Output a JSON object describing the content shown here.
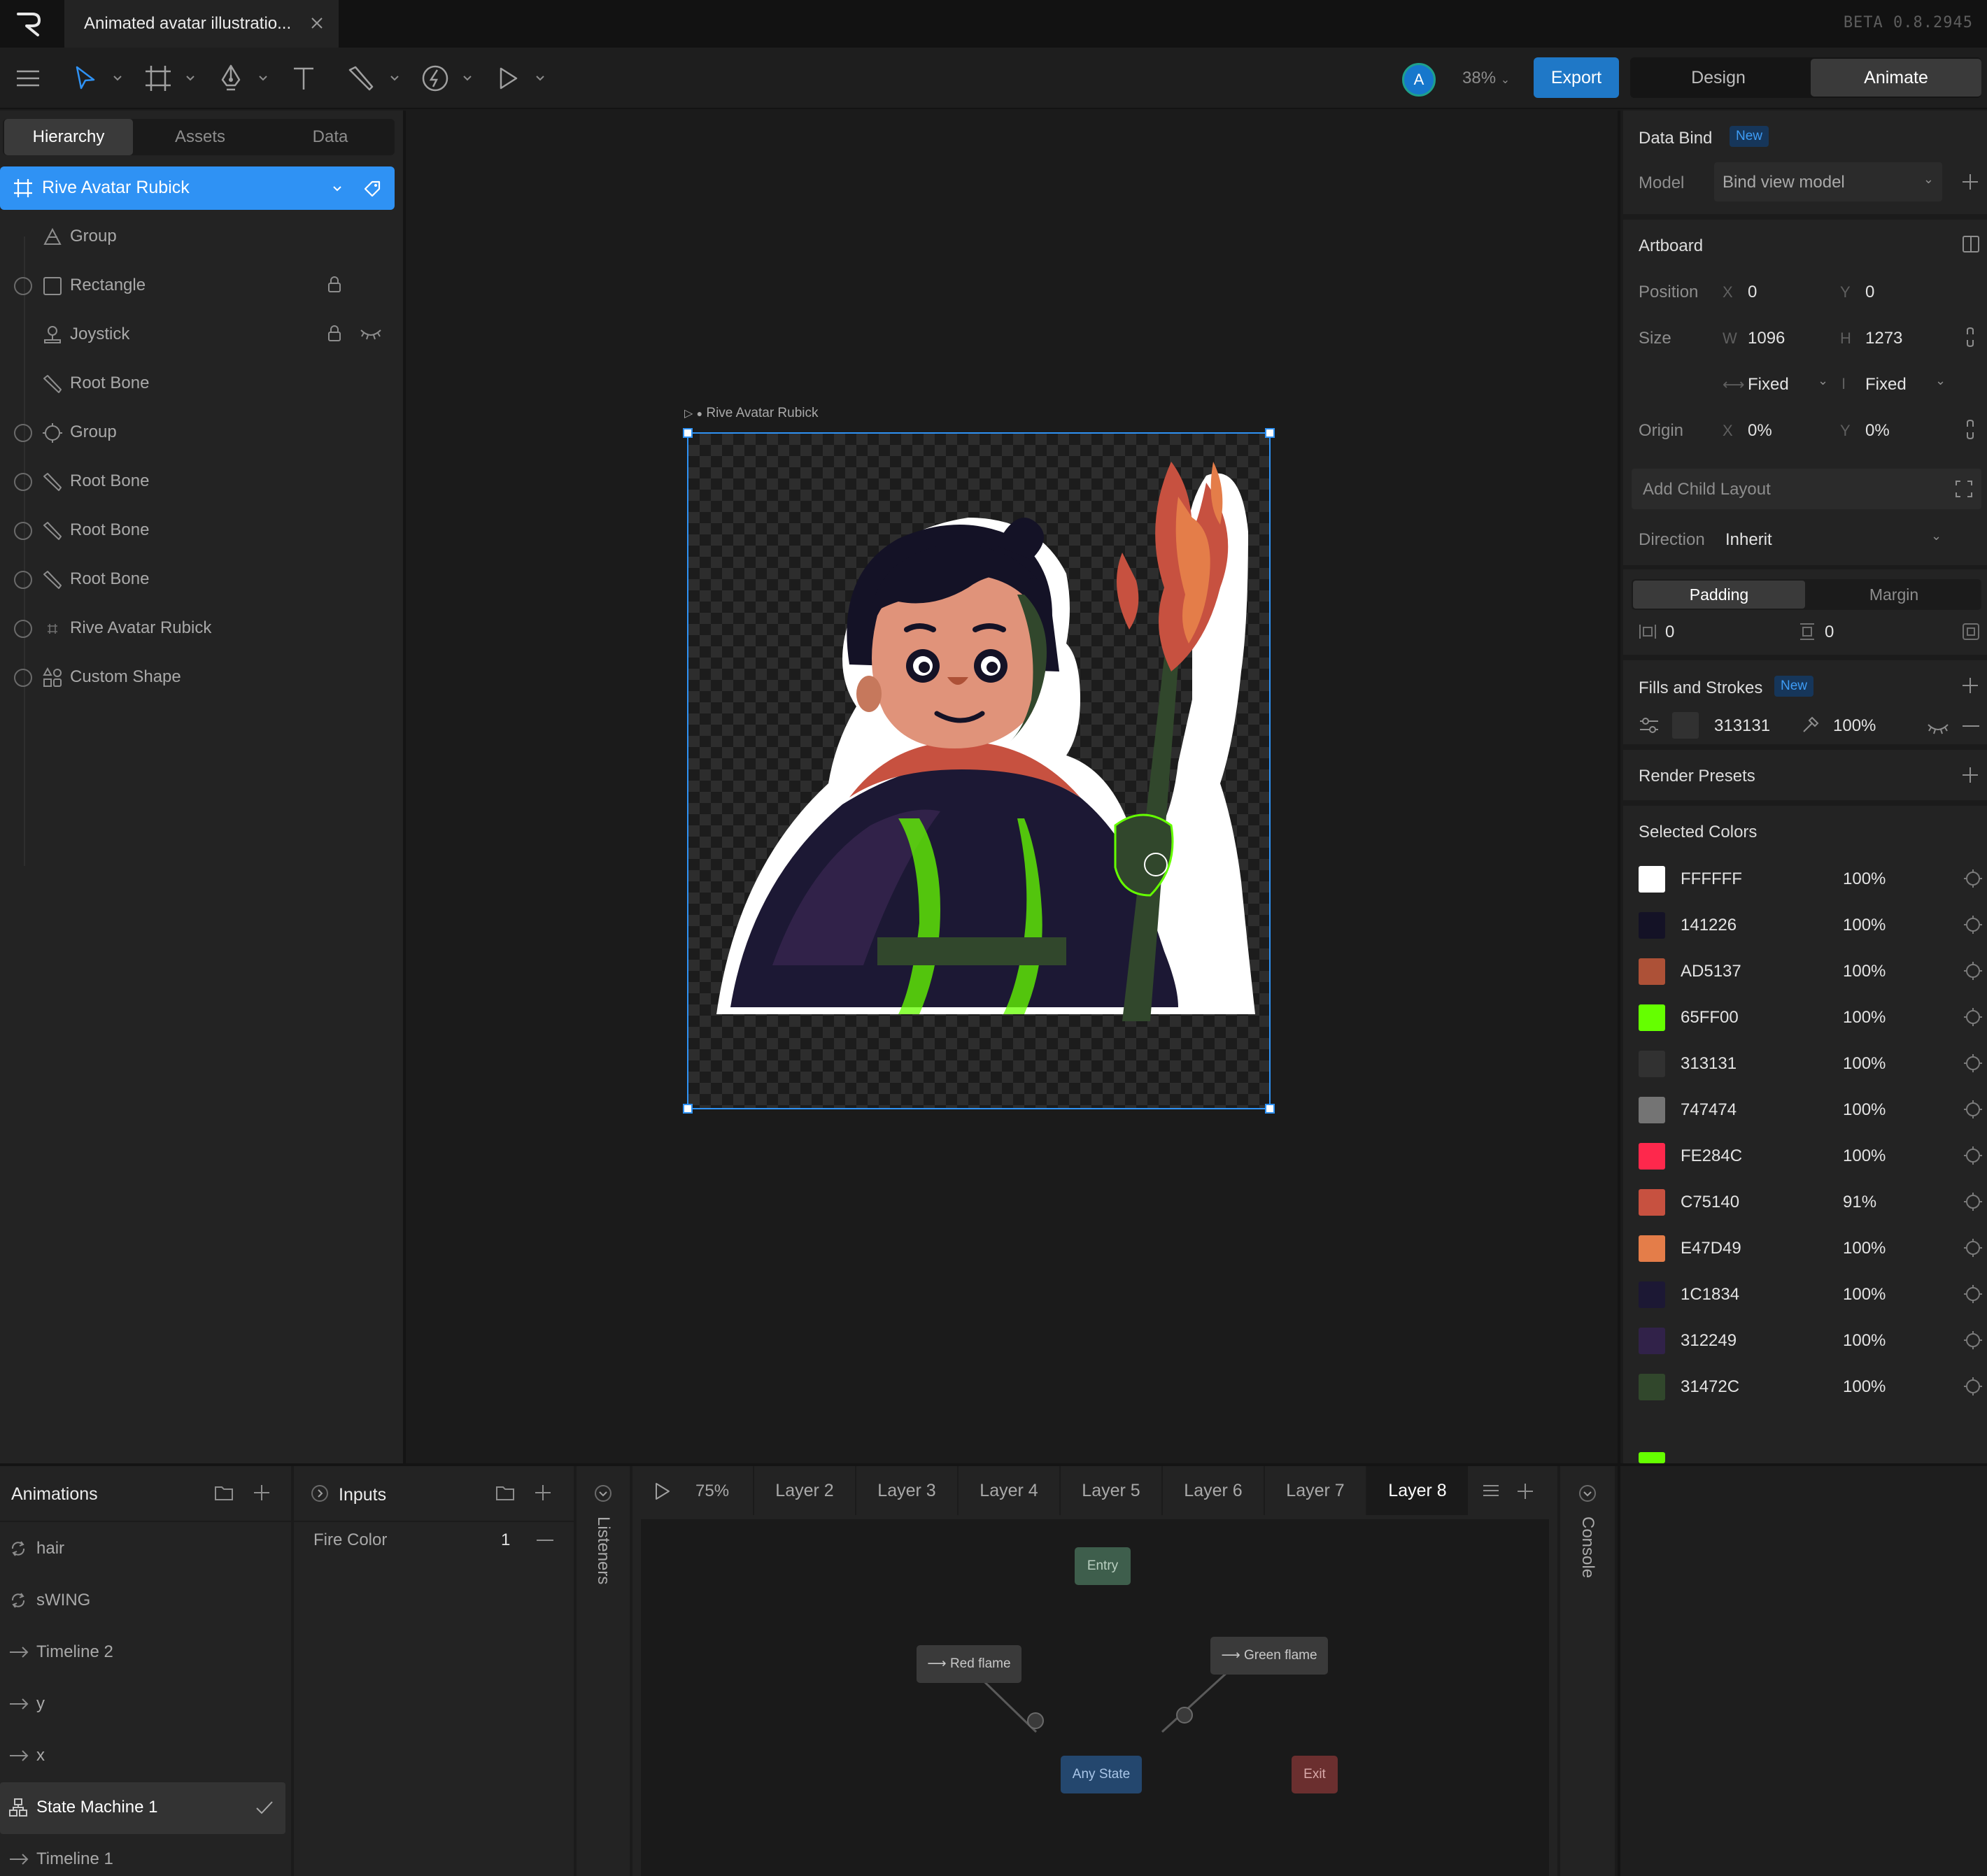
{
  "titlebar": {
    "doc_tab": "Animated avatar illustratio...",
    "version": "BETA 0.8.2945"
  },
  "toolbar": {
    "avatar_initial": "A",
    "zoom": "38%",
    "export": "Export",
    "mode_design": "Design",
    "mode_animate": "Animate"
  },
  "left": {
    "tabs": [
      "Hierarchy",
      "Assets",
      "Data"
    ],
    "root": "Rive Avatar Rubick",
    "items": [
      {
        "label": "Group",
        "icon": "group-triangle-icon"
      },
      {
        "label": "Rectangle",
        "icon": "rectangle-icon"
      },
      {
        "label": "Joystick",
        "icon": "joystick-icon"
      },
      {
        "label": "Root Bone",
        "icon": "bone-icon"
      },
      {
        "label": "Group",
        "icon": "group-target-icon"
      },
      {
        "label": "Root Bone",
        "icon": "bone-icon"
      },
      {
        "label": "Root Bone",
        "icon": "bone-icon"
      },
      {
        "label": "Root Bone",
        "icon": "bone-icon"
      },
      {
        "label": "Rive Avatar Rubick",
        "icon": "nested-artboard-icon"
      },
      {
        "label": "Custom Shape",
        "icon": "shapes-icon"
      }
    ]
  },
  "canvas": {
    "artboard_title": "Rive Avatar Rubick"
  },
  "right": {
    "data_bind": {
      "title": "Data Bind",
      "badge": "New",
      "model_label": "Model",
      "model_value": "Bind view model"
    },
    "artboard": {
      "title": "Artboard",
      "position_label": "Position",
      "x_axis": "X",
      "y_axis": "Y",
      "pos_x": "0",
      "pos_y": "0",
      "size_label": "Size",
      "w_axis": "W",
      "h_axis": "H",
      "w": "1096",
      "h": "1273",
      "w_mode": "Fixed",
      "h_mode": "Fixed",
      "origin_label": "Origin",
      "origin_x": "0%",
      "origin_y": "0%"
    },
    "layout": {
      "add_child": "Add Child Layout",
      "direction_label": "Direction",
      "direction_value": "Inherit",
      "padding_tab": "Padding",
      "margin_tab": "Margin",
      "pad_a": "0",
      "pad_b": "0"
    },
    "fills": {
      "title": "Fills and Strokes",
      "badge": "New",
      "hex": "313131",
      "opacity": "100%"
    },
    "render_presets": {
      "title": "Render Presets"
    },
    "selected_colors": {
      "title": "Selected Colors",
      "colors": [
        {
          "hex": "FFFFFF",
          "pct": "100%",
          "swatch": "#FFFFFF"
        },
        {
          "hex": "141226",
          "pct": "100%",
          "swatch": "#141226"
        },
        {
          "hex": "AD5137",
          "pct": "100%",
          "swatch": "#AD5137"
        },
        {
          "hex": "65FF00",
          "pct": "100%",
          "swatch": "#65FF00"
        },
        {
          "hex": "313131",
          "pct": "100%",
          "swatch": "#313131"
        },
        {
          "hex": "747474",
          "pct": "100%",
          "swatch": "#747474"
        },
        {
          "hex": "FE284C",
          "pct": "100%",
          "swatch": "#FE284C"
        },
        {
          "hex": "C75140",
          "pct": "91%",
          "swatch": "#C75140"
        },
        {
          "hex": "E47D49",
          "pct": "100%",
          "swatch": "#E47D49"
        },
        {
          "hex": "1C1834",
          "pct": "100%",
          "swatch": "#1C1834"
        },
        {
          "hex": "312249",
          "pct": "100%",
          "swatch": "#312249"
        },
        {
          "hex": "31472C",
          "pct": "100%",
          "swatch": "#31472C"
        }
      ]
    }
  },
  "bottom": {
    "animations": {
      "title": "Animations",
      "items": [
        {
          "label": "hair",
          "icon": "loop-icon"
        },
        {
          "label": "sWING",
          "icon": "loop-icon"
        },
        {
          "label": "Timeline 2",
          "icon": "arrow-right-icon"
        },
        {
          "label": "y",
          "icon": "arrow-right-icon"
        },
        {
          "label": "x",
          "icon": "arrow-right-icon"
        },
        {
          "label": "State Machine 1",
          "icon": "state-machine-icon"
        },
        {
          "label": "Timeline 1",
          "icon": "arrow-right-icon"
        }
      ]
    },
    "inputs": {
      "title": "Inputs",
      "name": "Fire Color",
      "value": "1"
    },
    "listeners": "Listeners",
    "console": "Console",
    "state_machine": {
      "zoom": "75%",
      "layers": [
        "Layer 2",
        "Layer 3",
        "Layer 4",
        "Layer 5",
        "Layer 6",
        "Layer 7",
        "Layer 8"
      ],
      "nodes": {
        "entry": "Entry",
        "red": "Red flame",
        "green": "Green flame",
        "any": "Any State",
        "exit": "Exit"
      }
    }
  }
}
